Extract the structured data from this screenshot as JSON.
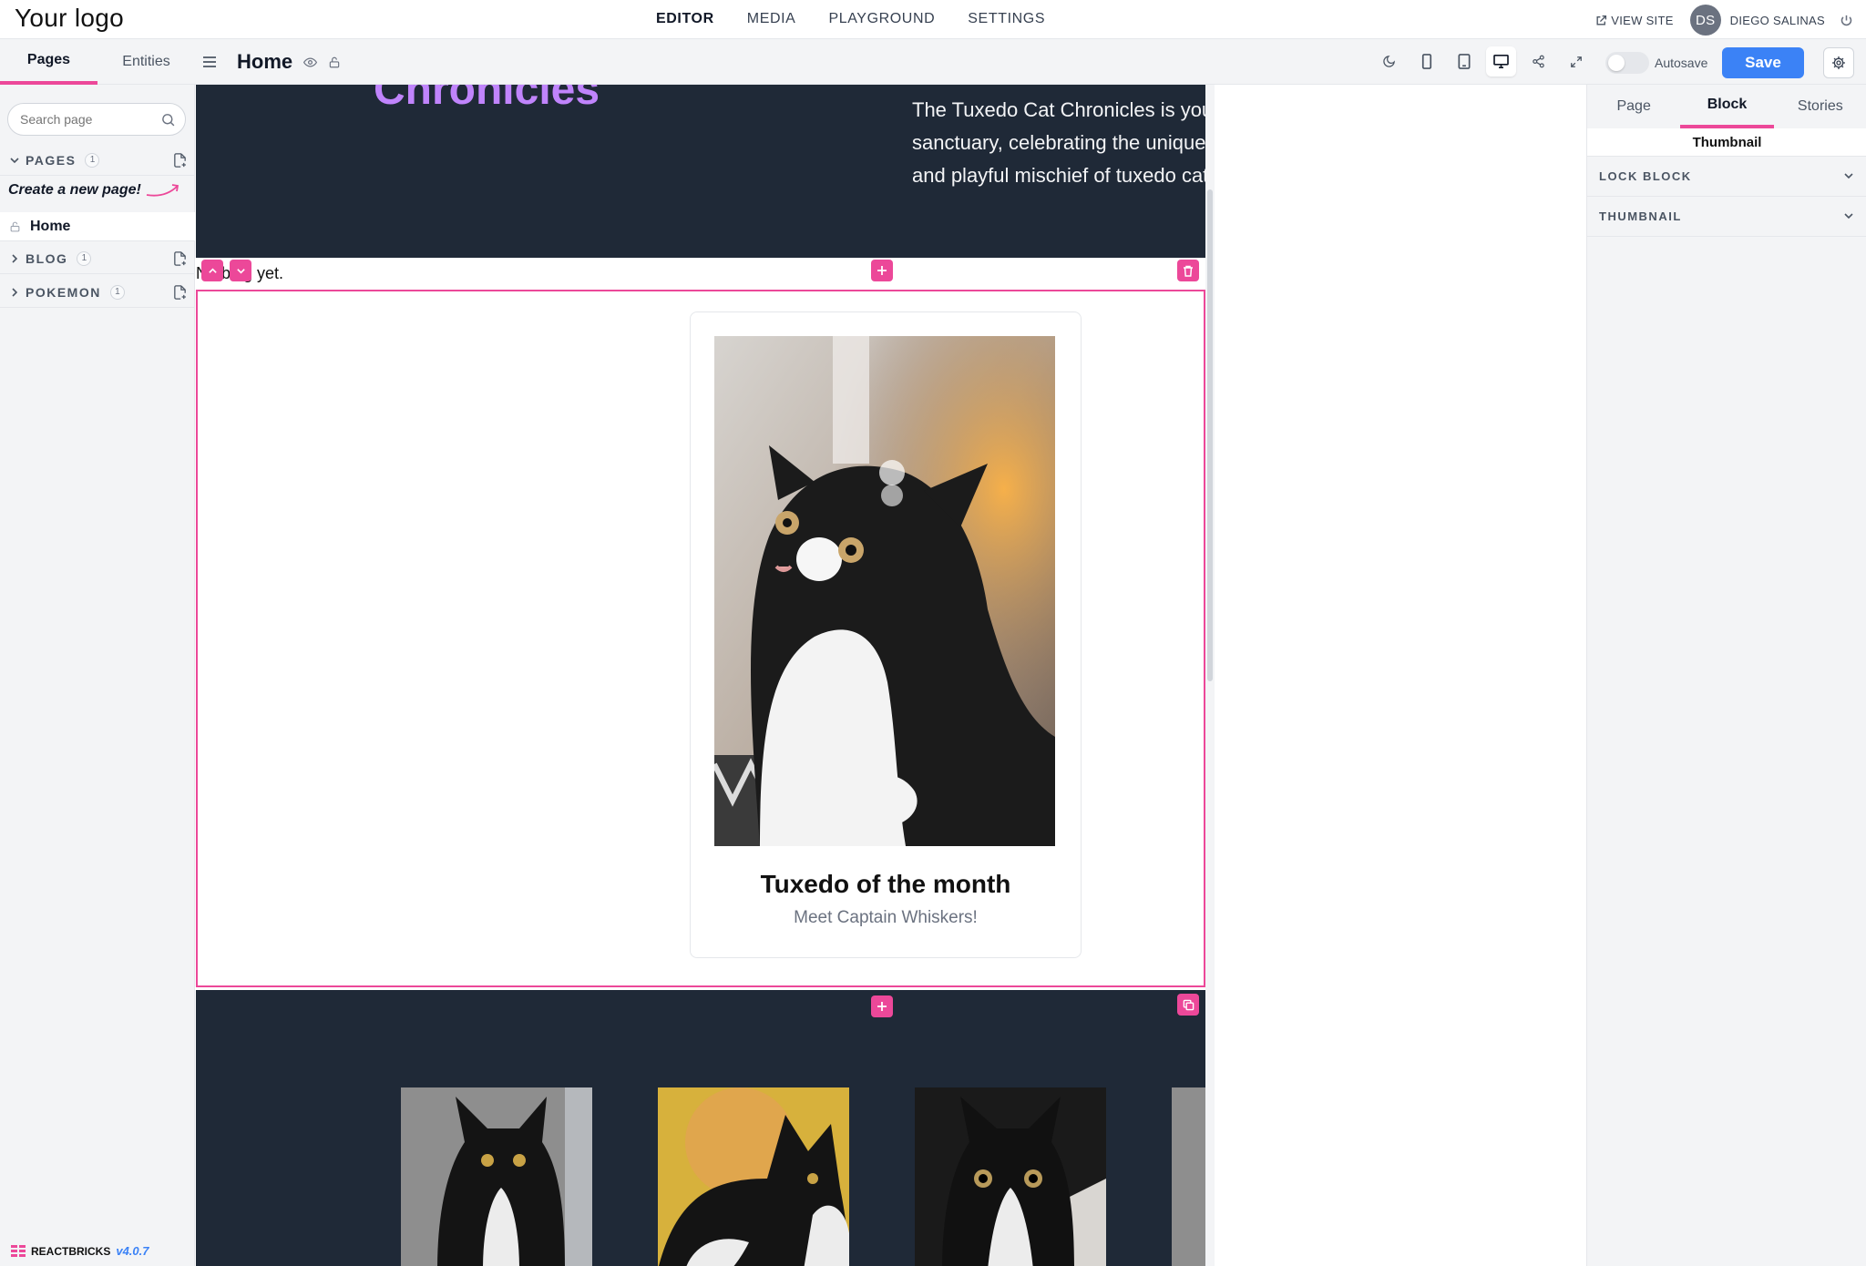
{
  "topbar": {
    "logo": "Your logo",
    "nav": [
      {
        "label": "EDITOR",
        "active": true
      },
      {
        "label": "MEDIA",
        "active": false
      },
      {
        "label": "PLAYGROUND",
        "active": false
      },
      {
        "label": "SETTINGS",
        "active": false
      }
    ],
    "view_site": "VIEW SITE",
    "avatar_initials": "DS",
    "user_name": "DIEGO SALINAS"
  },
  "left_tabs": {
    "pages": "Pages",
    "entities": "Entities"
  },
  "page_header": {
    "title": "Home"
  },
  "toolbar": {
    "autosave_label": "Autosave",
    "autosave_on": false,
    "save_label": "Save"
  },
  "sidebar": {
    "search_placeholder": "Search page",
    "sections": [
      {
        "label": "PAGES",
        "count": "1"
      },
      {
        "label": "BLOG",
        "count": "1"
      },
      {
        "label": "POKEMON",
        "count": "1"
      }
    ],
    "create_hint": "Create a new page!",
    "pages": [
      {
        "name": "Home"
      }
    ],
    "footer_brand": "REACTBRICKS",
    "footer_version": "v4.0.7"
  },
  "canvas": {
    "hero_ghost_text": "Chronicles",
    "hero_description": "The Tuxedo Cat Chronicles is your ultimate sanctuary, celebrating the unique charm, elegance, and playful mischief of tuxedo cats.",
    "blog_line": "No blog yet.",
    "card_title": "Tuxedo of the month",
    "card_subtitle": "Meet Captain Whiskers!"
  },
  "right_panel": {
    "tabs": [
      {
        "label": "Page",
        "active": false
      },
      {
        "label": "Block",
        "active": true
      },
      {
        "label": "Stories",
        "active": false
      }
    ],
    "block_name": "Thumbnail",
    "accordions": [
      "LOCK BLOCK",
      "THUMBNAIL"
    ]
  },
  "colors": {
    "accent_pink": "#ec4899",
    "save_blue": "#3b82f6",
    "hero_bg": "#1f2937",
    "ghost_purple": "#c084fc"
  }
}
